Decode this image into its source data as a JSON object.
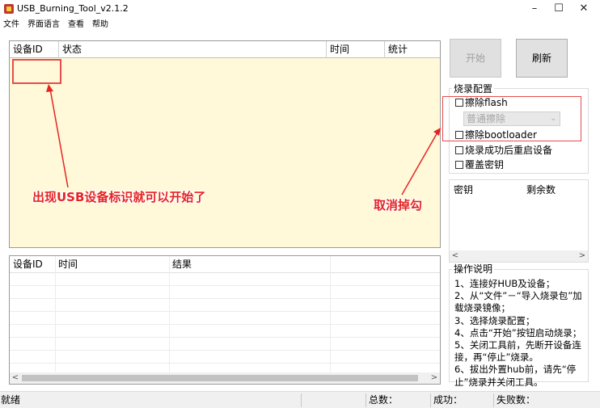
{
  "window": {
    "title": "USB_Burning_Tool_v2.1.2",
    "minimize_glyph": "–",
    "maximize_glyph": "☐",
    "close_glyph": "✕"
  },
  "menu": [
    "文件",
    "界面语言",
    "查看",
    "帮助"
  ],
  "device_table": {
    "columns": [
      "设备ID",
      "状态",
      "时间",
      "统计"
    ]
  },
  "result_table": {
    "columns": [
      "设备ID",
      "时间",
      "结果"
    ]
  },
  "buttons": {
    "start": "开始",
    "refresh": "刷新"
  },
  "burn_config": {
    "title": "烧录配置",
    "erase_flash": "擦除flash",
    "erase_mode": "普通擦除",
    "erase_bootloader": "擦除bootloader",
    "reboot_after": "烧录成功后重启设备",
    "overwrite_key": "覆盖密钥"
  },
  "key_table": {
    "columns": [
      "密钥",
      "剩余数"
    ]
  },
  "instructions": {
    "title": "操作说明",
    "text": "1、连接好HUB及设备；\n2、从“文件”－“导入烧录包”加载烧录镜像；\n3、选择烧录配置；\n4、点击“开始”按钮启动烧录；\n5、关闭工具前，先断开设备连接，再“停止”烧录。\n6、拔出外置hub前，请先“停止”烧录并关闭工具。"
  },
  "annotations": {
    "left": "出现USB设备标识就可以开始了",
    "right": "取消掉勾"
  },
  "status": {
    "ready": "就绪",
    "total": "总数：",
    "success": "成功：",
    "fail": "失败数："
  },
  "colors": {
    "device_bg": "#fff9d9",
    "annotation_red": "#e52424"
  }
}
